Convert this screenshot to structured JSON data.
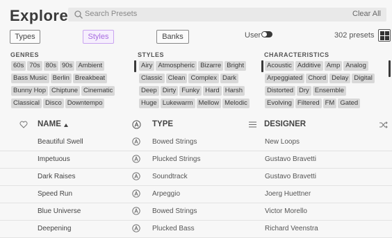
{
  "header": {
    "title": "Explore",
    "search_placeholder": "Search Presets",
    "clear_all": "Clear All"
  },
  "filter_tabs": {
    "types": "Types",
    "styles": "Styles",
    "banks": "Banks",
    "active": "Styles"
  },
  "user_label": "User",
  "preset_count": "302 presets",
  "columns": [
    {
      "title": "GENRES",
      "rows": [
        [
          "60s",
          "70s",
          "80s",
          "90s",
          "Ambient"
        ],
        [
          "Bass Music",
          "Berlin",
          "Breakbeat"
        ],
        [
          "Bunny Hop",
          "Chiptune",
          "Cinematic"
        ],
        [
          "Classical",
          "Disco",
          "Downtempo"
        ]
      ]
    },
    {
      "title": "STYLES",
      "rows": [
        [
          "Airy",
          "Atmospheric",
          "Bizarre",
          "Bright"
        ],
        [
          "Classic",
          "Clean",
          "Complex",
          "Dark"
        ],
        [
          "Deep",
          "Dirty",
          "Funky",
          "Hard",
          "Harsh"
        ],
        [
          "Huge",
          "Lukewarm",
          "Mellow",
          "Melodic"
        ]
      ]
    },
    {
      "title": "CHARACTERISTICS",
      "rows": [
        [
          "Acoustic",
          "Additive",
          "Amp",
          "Analog"
        ],
        [
          "Arpeggiated",
          "Chord",
          "Delay",
          "Digital"
        ],
        [
          "Distorted",
          "Dry",
          "Ensemble"
        ],
        [
          "Evolving",
          "Filtered",
          "FM",
          "Gated"
        ]
      ]
    }
  ],
  "table": {
    "headers": {
      "name": "NAME",
      "type": "TYPE",
      "designer": "DESIGNER"
    },
    "rows": [
      {
        "name": "Beautiful Swell",
        "type": "Bowed Strings",
        "designer": "New Loops"
      },
      {
        "name": "Impetuous",
        "type": "Plucked Strings",
        "designer": "Gustavo Bravetti"
      },
      {
        "name": "Dark Raises",
        "type": "Soundtrack",
        "designer": "Gustavo Bravetti"
      },
      {
        "name": "Speed Run",
        "type": "Arpeggio",
        "designer": "Joerg Huettner"
      },
      {
        "name": "Blue Universe",
        "type": "Bowed Strings",
        "designer": "Victor Morello"
      },
      {
        "name": "Deepening",
        "type": "Plucked Bass",
        "designer": "Richard Veenstra"
      }
    ]
  },
  "colors": {
    "styles_accent": "#a76be0",
    "tag_bg": "#d8d8d8",
    "background": "#f7f7f7"
  }
}
